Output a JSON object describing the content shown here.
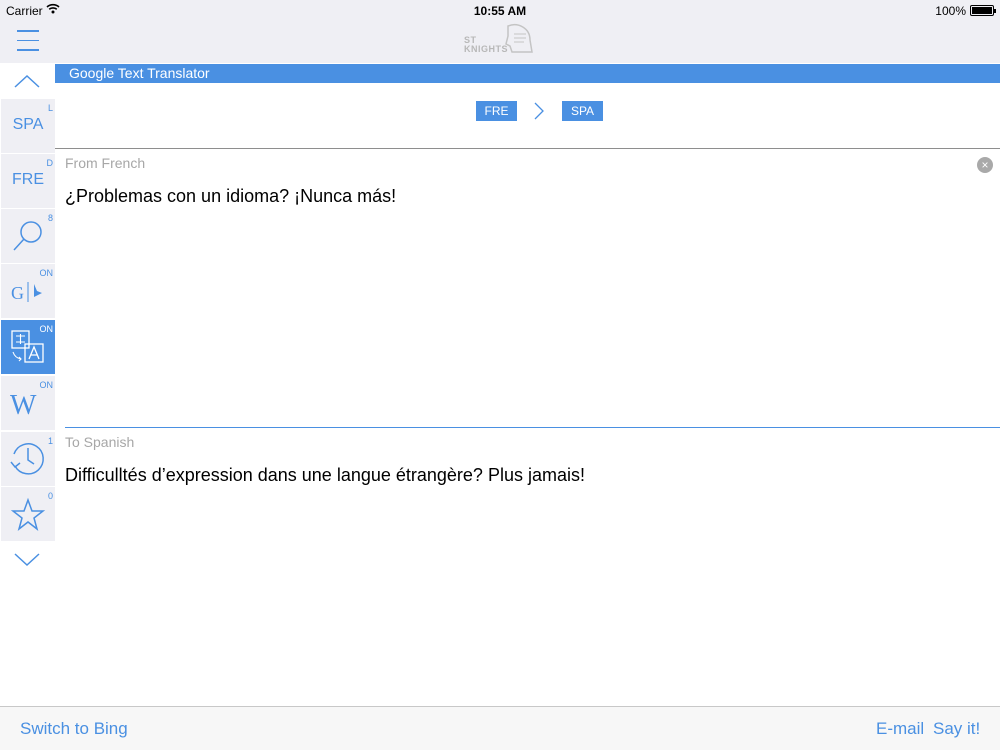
{
  "status_bar": {
    "carrier": "Carrier",
    "time": "10:55 AM",
    "battery": "100%"
  },
  "header": {
    "logo_text_top": "ST",
    "logo_text_bottom": "KNIGHTS"
  },
  "sidebar": {
    "items": [
      {
        "label": "SPA",
        "badge": "L",
        "active": false
      },
      {
        "label": "FRE",
        "badge": "D",
        "active": false
      },
      {
        "icon": "search-icon",
        "badge": "8",
        "active": false
      },
      {
        "icon": "google-bing-icon",
        "badge": "ON",
        "glyph_g": "G",
        "active": false
      },
      {
        "icon": "translate-icon",
        "badge": "ON",
        "active": true
      },
      {
        "icon": "wikipedia-icon",
        "badge": "ON",
        "glyph_w": "W",
        "active": false
      },
      {
        "icon": "history-icon",
        "badge": "1",
        "active": false
      },
      {
        "icon": "star-icon",
        "badge": "0",
        "active": false
      }
    ]
  },
  "main": {
    "title": "Google Text Translator",
    "source_lang": "FRE",
    "target_lang": "SPA",
    "from_label": "From French",
    "from_text": "¿Problemas con un idioma? ¡Nunca más!",
    "to_label": "To Spanish",
    "to_text": "Difficulltés d’expression dans une langue étrangère? Plus jamais!"
  },
  "toolbar": {
    "switch_label": "Switch to Bing",
    "email_label": "E-mail",
    "say_label": "Say it!"
  },
  "colors": {
    "accent": "#4a90e2",
    "nav_bg": "#efeff4"
  }
}
